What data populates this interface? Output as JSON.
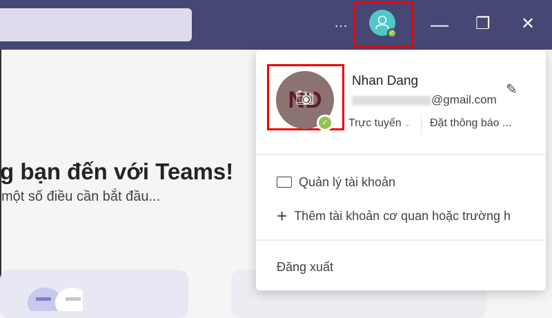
{
  "header": {
    "more_icon": "…",
    "minimize": "—",
    "maximize": "❐",
    "close": "✕"
  },
  "main": {
    "title": "g bạn đến với Teams!",
    "subtitle": "một số điều cần bắt đầu..."
  },
  "profile": {
    "initials": "ND",
    "name": "Nhan Dang",
    "email_suffix": "@gmail.com",
    "status": "Trực tuyến",
    "status_chevron": "⌄",
    "notification": "Đặt thông báo ...",
    "menu": [
      {
        "icon": "id-card-icon",
        "label": "Quản lý tài khoản"
      },
      {
        "icon": "plus-icon",
        "label": "Thêm tài khoản cơ quan hoặc trường h"
      }
    ],
    "sign_out": "Đăng xuất"
  },
  "colors": {
    "header": "#464775",
    "status_green": "#92c353",
    "avatar": "#4fc9c5"
  }
}
